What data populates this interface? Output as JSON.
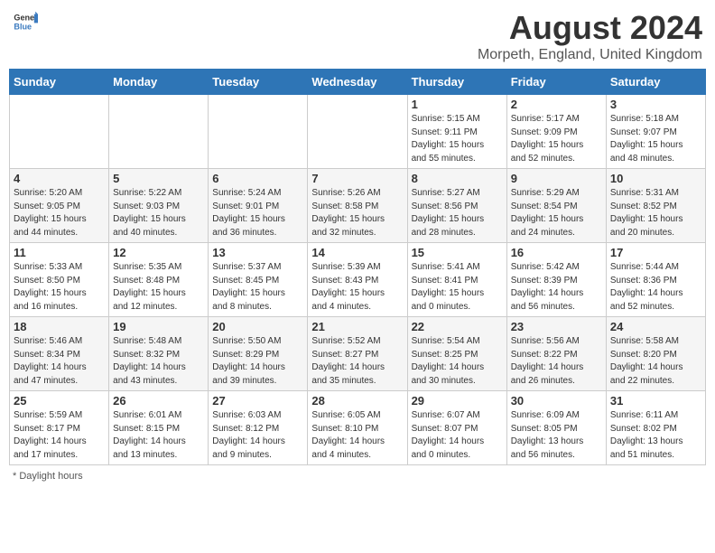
{
  "header": {
    "logo_general": "General",
    "logo_blue": "Blue",
    "main_title": "August 2024",
    "subtitle": "Morpeth, England, United Kingdom"
  },
  "days_of_week": [
    "Sunday",
    "Monday",
    "Tuesday",
    "Wednesday",
    "Thursday",
    "Friday",
    "Saturday"
  ],
  "weeks": [
    [
      {
        "day": "",
        "info": ""
      },
      {
        "day": "",
        "info": ""
      },
      {
        "day": "",
        "info": ""
      },
      {
        "day": "",
        "info": ""
      },
      {
        "day": "1",
        "info": "Sunrise: 5:15 AM\nSunset: 9:11 PM\nDaylight: 15 hours\nand 55 minutes."
      },
      {
        "day": "2",
        "info": "Sunrise: 5:17 AM\nSunset: 9:09 PM\nDaylight: 15 hours\nand 52 minutes."
      },
      {
        "day": "3",
        "info": "Sunrise: 5:18 AM\nSunset: 9:07 PM\nDaylight: 15 hours\nand 48 minutes."
      }
    ],
    [
      {
        "day": "4",
        "info": "Sunrise: 5:20 AM\nSunset: 9:05 PM\nDaylight: 15 hours\nand 44 minutes."
      },
      {
        "day": "5",
        "info": "Sunrise: 5:22 AM\nSunset: 9:03 PM\nDaylight: 15 hours\nand 40 minutes."
      },
      {
        "day": "6",
        "info": "Sunrise: 5:24 AM\nSunset: 9:01 PM\nDaylight: 15 hours\nand 36 minutes."
      },
      {
        "day": "7",
        "info": "Sunrise: 5:26 AM\nSunset: 8:58 PM\nDaylight: 15 hours\nand 32 minutes."
      },
      {
        "day": "8",
        "info": "Sunrise: 5:27 AM\nSunset: 8:56 PM\nDaylight: 15 hours\nand 28 minutes."
      },
      {
        "day": "9",
        "info": "Sunrise: 5:29 AM\nSunset: 8:54 PM\nDaylight: 15 hours\nand 24 minutes."
      },
      {
        "day": "10",
        "info": "Sunrise: 5:31 AM\nSunset: 8:52 PM\nDaylight: 15 hours\nand 20 minutes."
      }
    ],
    [
      {
        "day": "11",
        "info": "Sunrise: 5:33 AM\nSunset: 8:50 PM\nDaylight: 15 hours\nand 16 minutes."
      },
      {
        "day": "12",
        "info": "Sunrise: 5:35 AM\nSunset: 8:48 PM\nDaylight: 15 hours\nand 12 minutes."
      },
      {
        "day": "13",
        "info": "Sunrise: 5:37 AM\nSunset: 8:45 PM\nDaylight: 15 hours\nand 8 minutes."
      },
      {
        "day": "14",
        "info": "Sunrise: 5:39 AM\nSunset: 8:43 PM\nDaylight: 15 hours\nand 4 minutes."
      },
      {
        "day": "15",
        "info": "Sunrise: 5:41 AM\nSunset: 8:41 PM\nDaylight: 15 hours\nand 0 minutes."
      },
      {
        "day": "16",
        "info": "Sunrise: 5:42 AM\nSunset: 8:39 PM\nDaylight: 14 hours\nand 56 minutes."
      },
      {
        "day": "17",
        "info": "Sunrise: 5:44 AM\nSunset: 8:36 PM\nDaylight: 14 hours\nand 52 minutes."
      }
    ],
    [
      {
        "day": "18",
        "info": "Sunrise: 5:46 AM\nSunset: 8:34 PM\nDaylight: 14 hours\nand 47 minutes."
      },
      {
        "day": "19",
        "info": "Sunrise: 5:48 AM\nSunset: 8:32 PM\nDaylight: 14 hours\nand 43 minutes."
      },
      {
        "day": "20",
        "info": "Sunrise: 5:50 AM\nSunset: 8:29 PM\nDaylight: 14 hours\nand 39 minutes."
      },
      {
        "day": "21",
        "info": "Sunrise: 5:52 AM\nSunset: 8:27 PM\nDaylight: 14 hours\nand 35 minutes."
      },
      {
        "day": "22",
        "info": "Sunrise: 5:54 AM\nSunset: 8:25 PM\nDaylight: 14 hours\nand 30 minutes."
      },
      {
        "day": "23",
        "info": "Sunrise: 5:56 AM\nSunset: 8:22 PM\nDaylight: 14 hours\nand 26 minutes."
      },
      {
        "day": "24",
        "info": "Sunrise: 5:58 AM\nSunset: 8:20 PM\nDaylight: 14 hours\nand 22 minutes."
      }
    ],
    [
      {
        "day": "25",
        "info": "Sunrise: 5:59 AM\nSunset: 8:17 PM\nDaylight: 14 hours\nand 17 minutes."
      },
      {
        "day": "26",
        "info": "Sunrise: 6:01 AM\nSunset: 8:15 PM\nDaylight: 14 hours\nand 13 minutes."
      },
      {
        "day": "27",
        "info": "Sunrise: 6:03 AM\nSunset: 8:12 PM\nDaylight: 14 hours\nand 9 minutes."
      },
      {
        "day": "28",
        "info": "Sunrise: 6:05 AM\nSunset: 8:10 PM\nDaylight: 14 hours\nand 4 minutes."
      },
      {
        "day": "29",
        "info": "Sunrise: 6:07 AM\nSunset: 8:07 PM\nDaylight: 14 hours\nand 0 minutes."
      },
      {
        "day": "30",
        "info": "Sunrise: 6:09 AM\nSunset: 8:05 PM\nDaylight: 13 hours\nand 56 minutes."
      },
      {
        "day": "31",
        "info": "Sunrise: 6:11 AM\nSunset: 8:02 PM\nDaylight: 13 hours\nand 51 minutes."
      }
    ]
  ],
  "footer": {
    "note": "Daylight hours"
  }
}
